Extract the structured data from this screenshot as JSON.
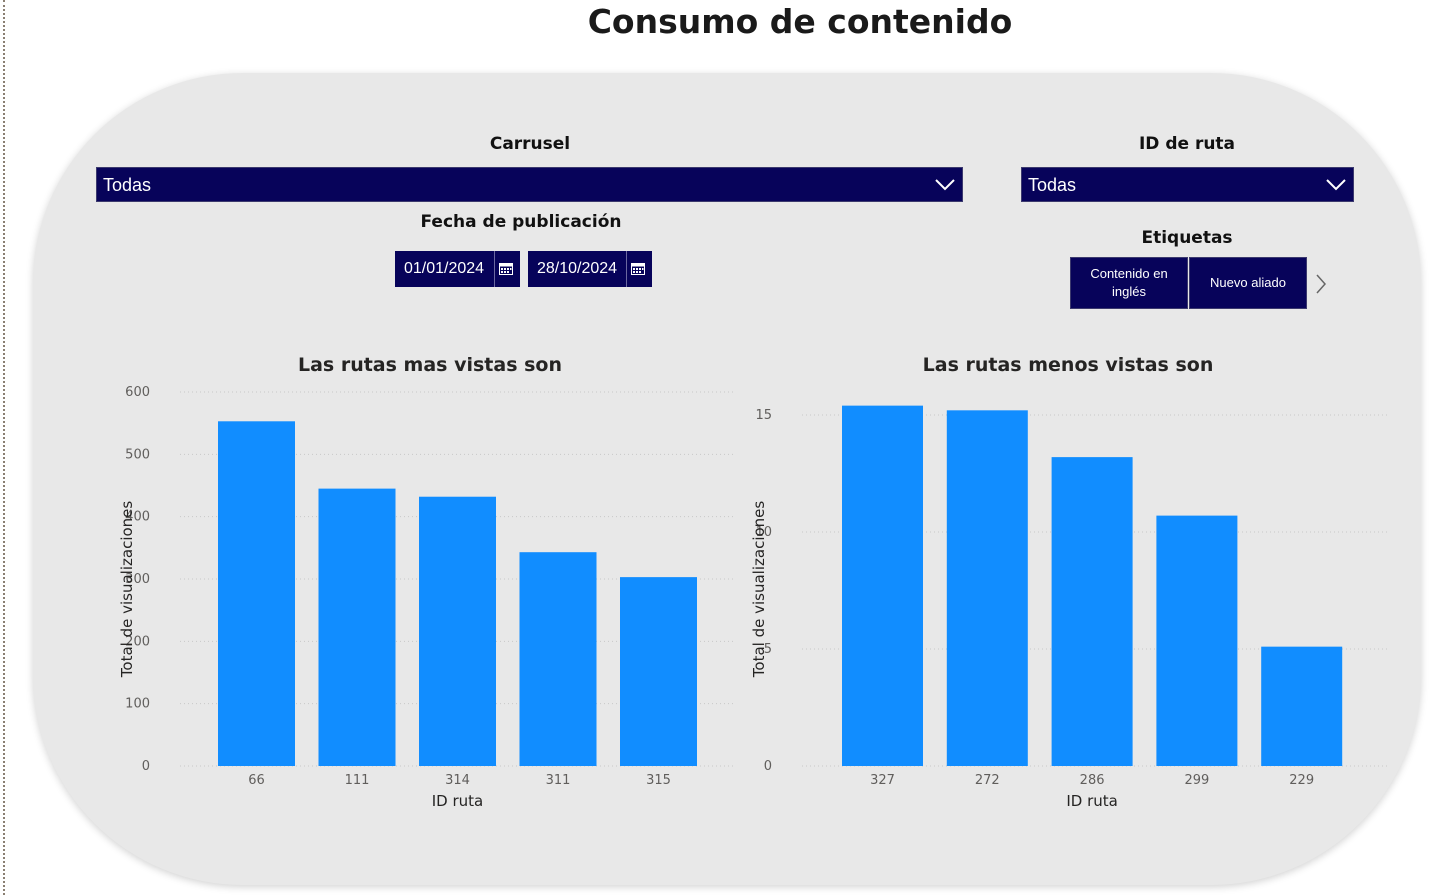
{
  "page": {
    "title": "Consumo de contenido"
  },
  "slicers": {
    "carrusel": {
      "title": "Carrusel",
      "value": "Todas"
    },
    "id_ruta": {
      "title": "ID de ruta",
      "value": "Todas"
    },
    "fecha": {
      "title": "Fecha de publicación",
      "start": "01/01/2024",
      "end": "28/10/2024"
    },
    "etiquetas": {
      "title": "Etiquetas",
      "buttons": [
        "Contenido en inglés",
        "Nuevo aliado"
      ]
    }
  },
  "colors": {
    "bar": "#118dff",
    "slicer_bg": "#07035a",
    "panel_bg": "#e8e8e8"
  },
  "chart_data": [
    {
      "type": "bar",
      "title": "Las rutas mas vistas son",
      "xlabel": "ID ruta",
      "ylabel": "Total de visualizaciones",
      "categories": [
        "66",
        "111",
        "314",
        "311",
        "315"
      ],
      "values": [
        553,
        445,
        432,
        343,
        303
      ],
      "ylim": [
        0,
        600
      ],
      "yticks": [
        0,
        100,
        200,
        300,
        400,
        500,
        600
      ],
      "grid": true
    },
    {
      "type": "bar",
      "title": "Las rutas menos vistas son",
      "xlabel": "ID ruta",
      "ylabel": "Total de visualizaciones",
      "categories": [
        "327",
        "272",
        "286",
        "299",
        "229"
      ],
      "values": [
        15.4,
        15.2,
        13.2,
        10.7,
        5.1
      ],
      "ylim": [
        0,
        15
      ],
      "yticks": [
        0,
        5,
        10,
        15
      ],
      "grid": true
    }
  ]
}
